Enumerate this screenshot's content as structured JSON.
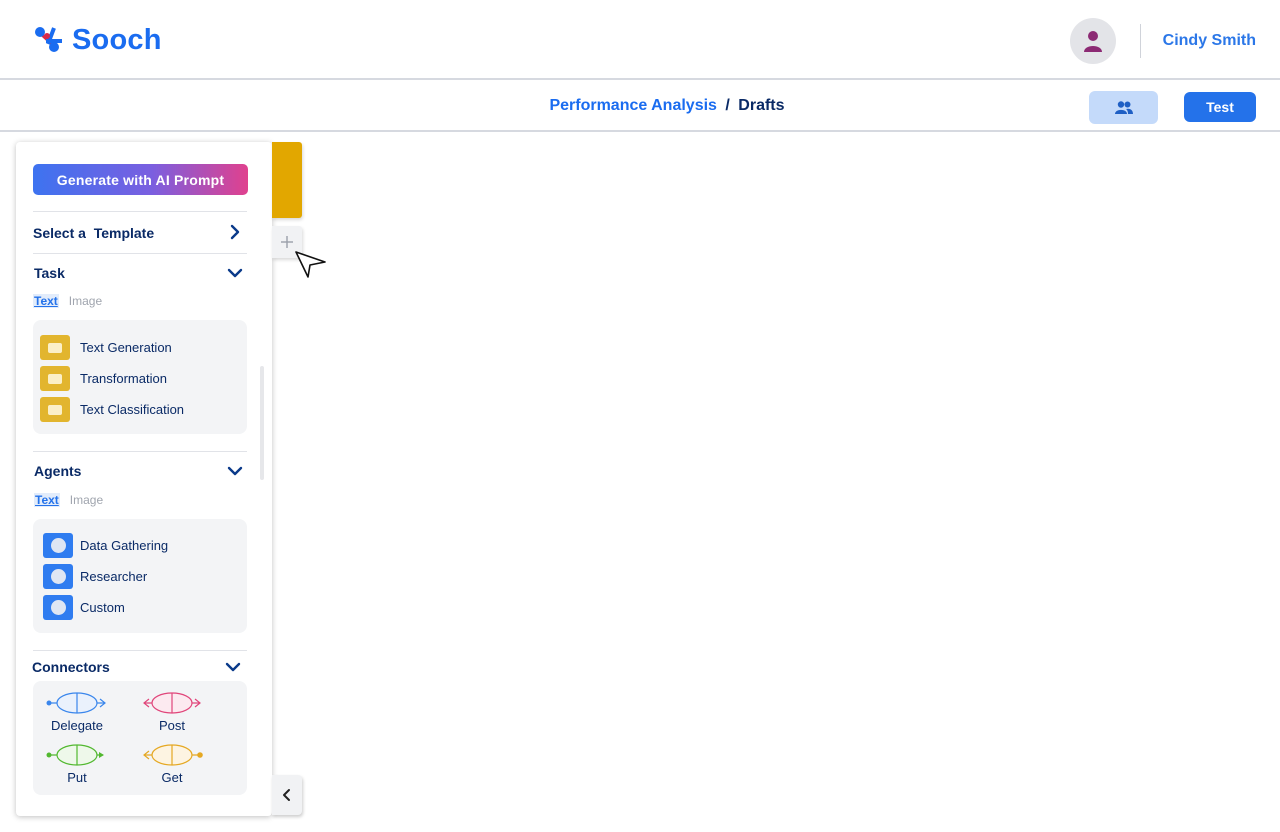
{
  "app": {
    "name": "Sooch",
    "brand_color": "#1a6cf0"
  },
  "user": {
    "name": "Cindy Smith",
    "avatar_icon": "person-icon"
  },
  "breadcrumb": {
    "project": "Performance Analysis",
    "separator": "/",
    "page": "Drafts"
  },
  "toolbar": {
    "collab_icon": "users-icon",
    "test_label": "Test"
  },
  "sidebar": {
    "generate_label": "Generate with AI Prompt",
    "template": {
      "label": "Select a  Template"
    },
    "task": {
      "title": "Task",
      "tabs": [
        "Text",
        "Image"
      ],
      "items": [
        "Text Generation",
        "Transformation",
        "Text Classification"
      ]
    },
    "agents": {
      "title": "Agents",
      "tabs": [
        "Text",
        "Image"
      ],
      "items": [
        "Data Gathering",
        "Researcher",
        "Custom"
      ]
    },
    "connectors": {
      "title": "Connectors",
      "items": [
        {
          "label": "Delegate",
          "color": "#3a86ec"
        },
        {
          "label": "Post",
          "color": "#e0457a"
        },
        {
          "label": "Put",
          "color": "#52b830"
        },
        {
          "label": "Get",
          "color": "#e5a823"
        }
      ]
    }
  }
}
